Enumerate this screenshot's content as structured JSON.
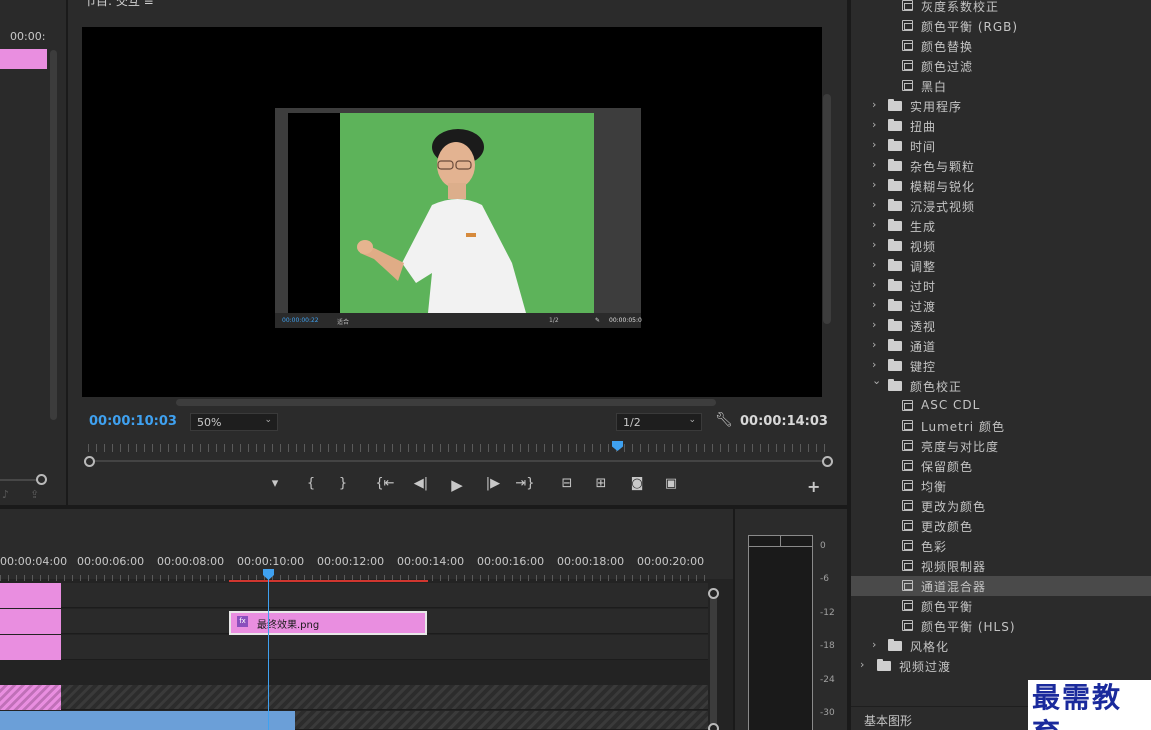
{
  "project_panel": {
    "timecode": "00:00:",
    "icons": [
      "speaker-icon",
      "export-icon"
    ]
  },
  "program_monitor": {
    "title": "节目: 交互 ≡",
    "current_time": "00:00:10:03",
    "zoom": "50%",
    "resolution": "1/2",
    "duration": "00:00:14:03",
    "nested_frame": {
      "timecode": "00:00:00:22",
      "zoom": "适合",
      "resolution": "1/2",
      "duration": "00:00:05:0"
    }
  },
  "transport": {
    "buttons": [
      "mark-in-icon",
      "in-bracket-icon",
      "out-bracket-icon",
      "go-to-in-icon",
      "step-back-icon",
      "play-icon",
      "step-forward-icon",
      "go-to-out-icon",
      "lift-icon",
      "extract-icon",
      "camera-icon",
      "compare-icon"
    ],
    "add_label": "+"
  },
  "timeline": {
    "ruler_labels": [
      "00:00:04:00",
      "00:00:06:00",
      "00:00:08:00",
      "00:00:10:00",
      "00:00:12:00",
      "00:00:14:00",
      "00:00:16:00",
      "00:00:18:00",
      "00:00:20:00"
    ],
    "clip": {
      "fx": "fx",
      "name": "最终效果.png"
    }
  },
  "audio_meter": {
    "db_labels": [
      "0",
      "-6",
      "-12",
      "-18",
      "-24",
      "-30"
    ]
  },
  "effects": {
    "items": [
      {
        "type": "effect",
        "label": "灰度系数校正"
      },
      {
        "type": "effect",
        "label": "颜色平衡 (RGB)"
      },
      {
        "type": "effect",
        "label": "颜色替换"
      },
      {
        "type": "effect",
        "label": "颜色过滤"
      },
      {
        "type": "effect",
        "label": "黑白"
      },
      {
        "type": "folder",
        "label": "实用程序"
      },
      {
        "type": "folder",
        "label": "扭曲"
      },
      {
        "type": "folder",
        "label": "时间"
      },
      {
        "type": "folder",
        "label": "杂色与颗粒"
      },
      {
        "type": "folder",
        "label": "模糊与锐化"
      },
      {
        "type": "folder",
        "label": "沉浸式视频"
      },
      {
        "type": "folder",
        "label": "生成"
      },
      {
        "type": "folder",
        "label": "视频"
      },
      {
        "type": "folder",
        "label": "调整"
      },
      {
        "type": "folder",
        "label": "过时"
      },
      {
        "type": "folder",
        "label": "过渡"
      },
      {
        "type": "folder",
        "label": "透视"
      },
      {
        "type": "folder",
        "label": "通道"
      },
      {
        "type": "folder",
        "label": "键控"
      },
      {
        "type": "folder-open",
        "label": "颜色校正"
      },
      {
        "type": "effect",
        "label": "ASC CDL"
      },
      {
        "type": "effect",
        "label": "Lumetri 颜色"
      },
      {
        "type": "effect",
        "label": "亮度与对比度"
      },
      {
        "type": "effect",
        "label": "保留颜色"
      },
      {
        "type": "effect",
        "label": "均衡"
      },
      {
        "type": "effect",
        "label": "更改为颜色"
      },
      {
        "type": "effect",
        "label": "更改颜色"
      },
      {
        "type": "effect",
        "label": "色彩"
      },
      {
        "type": "effect",
        "label": "视频限制器"
      },
      {
        "type": "effect",
        "label": "通道混合器",
        "selected": true
      },
      {
        "type": "effect",
        "label": "颜色平衡"
      },
      {
        "type": "effect",
        "label": "颜色平衡 (HLS)"
      },
      {
        "type": "folder",
        "label": "风格化"
      },
      {
        "type": "root-folder",
        "label": "视频过渡"
      }
    ],
    "footer": "基本图形",
    "watermark": "最需教育"
  },
  "colors": {
    "accent_blue": "#3fa1f0",
    "clip_pink": "#e98ee0",
    "green_screen": "#5db35a",
    "inout_red": "#d0362f"
  }
}
